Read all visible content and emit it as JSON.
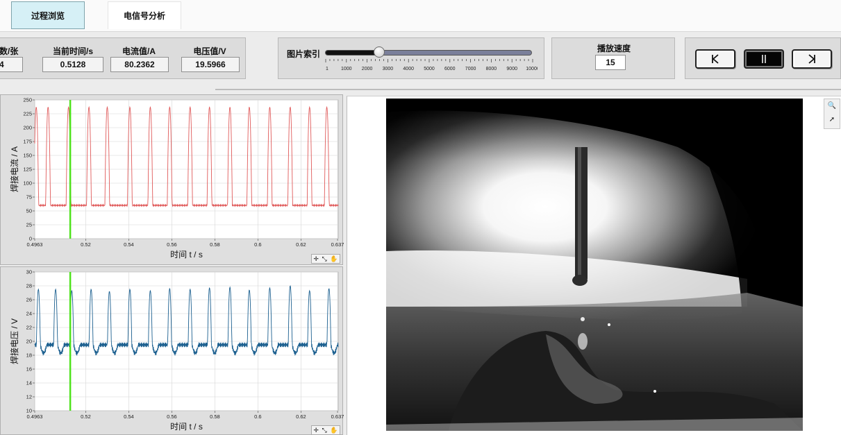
{
  "tabs": [
    {
      "label": "过程浏览",
      "active": true
    },
    {
      "label": "电信号分析",
      "active": false
    }
  ],
  "readouts": {
    "frames": {
      "label": "数/张",
      "value": "4"
    },
    "time": {
      "label": "当前时间/s",
      "value": "0.5128"
    },
    "current": {
      "label": "电流值/A",
      "value": "80.2362"
    },
    "voltage": {
      "label": "电压值/V",
      "value": "19.5966"
    }
  },
  "image_index": {
    "label": "图片索引",
    "position_fraction": 0.26,
    "scale": [
      "1",
      "1000",
      "2000",
      "3000",
      "4000",
      "5000",
      "6000",
      "7000",
      "8000",
      "9000",
      "10000"
    ]
  },
  "playback_speed": {
    "label": "播放速度",
    "value": "15"
  },
  "playback_buttons": [
    {
      "name": "step-back",
      "active": false
    },
    {
      "name": "pause",
      "active": true
    },
    {
      "name": "step-forward",
      "active": false
    }
  ],
  "colors": {
    "current_trace": "#e05a5a",
    "voltage_trace": "#1b5f8f",
    "cursor": "#4ee21c",
    "active_tab": "#d6f0f6"
  },
  "chart_data": [
    {
      "type": "line",
      "ylabel": "焊接电流 / A",
      "xlabel": "时间 t / s",
      "xlim": [
        0.4963,
        0.6373
      ],
      "ylim": [
        0,
        250
      ],
      "x_tick_labels": [
        "0.4963",
        "0.52",
        "0.54",
        "0.56",
        "0.58",
        "0.6",
        "0.62",
        "0.637"
      ],
      "y_tick_labels": [
        "0",
        "25",
        "50",
        "75",
        "100",
        "125",
        "150",
        "175",
        "200",
        "225",
        "250"
      ],
      "grid": true,
      "cursor_x": 0.5128,
      "series": [
        {
          "base": 60,
          "peak": 237,
          "pulse_times": [
            0.497,
            0.5025,
            0.512,
            0.5215,
            0.53,
            0.5405,
            0.55,
            0.559,
            0.5685,
            0.5775,
            0.587,
            0.596,
            0.6055,
            0.615,
            0.624,
            0.632
          ]
        }
      ]
    },
    {
      "type": "line",
      "ylabel": "焊接电压 / V",
      "xlabel": "时间 t / s",
      "xlim": [
        0.4963,
        0.6373
      ],
      "ylim": [
        10,
        30
      ],
      "x_tick_labels": [
        "0.4963",
        "0.52",
        "0.54",
        "0.56",
        "0.58",
        "0.6",
        "0.62",
        "0.637"
      ],
      "y_tick_labels": [
        "10",
        "12",
        "14",
        "16",
        "18",
        "20",
        "22",
        "24",
        "26",
        "28",
        "30"
      ],
      "grid": true,
      "cursor_x": 0.5128,
      "series": [
        {
          "base": 19.5,
          "peak_values": [
            27.5,
            27.5,
            27.3,
            27.5,
            27.2,
            27.5,
            27.3,
            27.6,
            27.5,
            27.7,
            27.8,
            27.4,
            27.7,
            28,
            27.3,
            27.6
          ],
          "pulse_times": [
            0.498,
            0.506,
            0.5135,
            0.5225,
            0.531,
            0.5405,
            0.55,
            0.559,
            0.5685,
            0.5775,
            0.587,
            0.596,
            0.6055,
            0.615,
            0.624,
            0.633
          ]
        }
      ]
    }
  ]
}
